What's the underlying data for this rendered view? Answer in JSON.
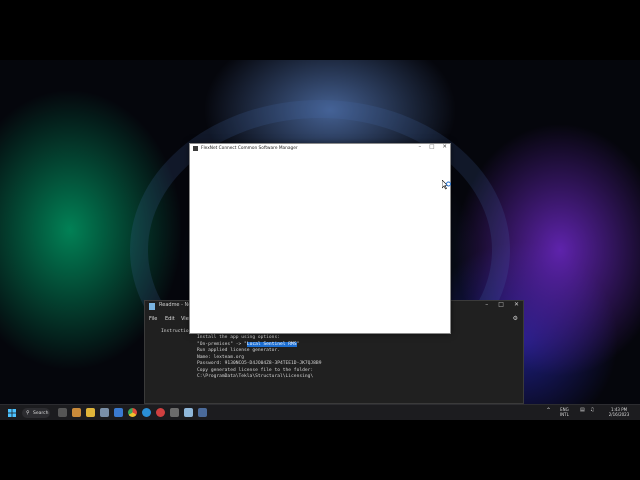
{
  "notepad": {
    "title": "Readme - Notepad",
    "menu": [
      "File",
      "Edit",
      "View"
    ],
    "lines": [
      {
        "text": "Instructions:"
      },
      {
        "text": "Install the app using options:"
      },
      {
        "pre": "\"On-premises\" -> \"",
        "hl": "Local Sentinel RMS",
        "post": "\""
      },
      {
        "text": "Run applied license generator."
      },
      {
        "text": "Name: lexteam.org"
      },
      {
        "text": "Password: 9130NCO5-D4JO04Z8-3P4TEE1D-JK7QJ8B9"
      },
      {
        "text": "Copy generated license file to the folder:"
      },
      {
        "text": "C:\\ProgramData\\Tekla\\Structural\\Licensing\\"
      }
    ]
  },
  "installer": {
    "title": "FlexNet Connect Common Software Manager"
  },
  "taskbar": {
    "search_label": "Search",
    "language": "ENG",
    "region": "INTL",
    "time": "1:43 PM",
    "date": "2/16/2023"
  },
  "colors": {
    "selection": "#1d6ed1",
    "taskbar": "#1c1c1f"
  }
}
